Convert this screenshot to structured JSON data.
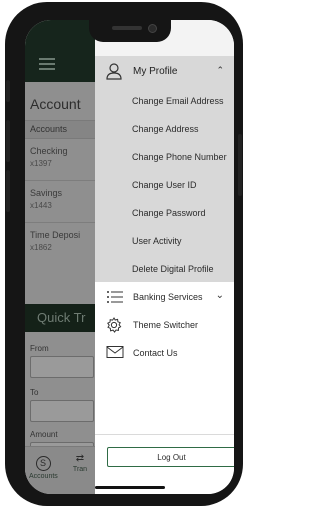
{
  "app": {
    "accounts_title": "Account",
    "accounts_subheader": "Accounts",
    "accounts": [
      {
        "name": "Checking",
        "number": "x1397"
      },
      {
        "name": "Savings",
        "number": "x1443"
      },
      {
        "name": "Time Deposi",
        "number": "x1862"
      }
    ],
    "quick_transfer_title": "Quick Tr",
    "form": {
      "from_label": "From",
      "to_label": "To",
      "amount_label": "Amount",
      "amount_prefix": "$"
    },
    "tabs": {
      "accounts_label": "Accounts",
      "accounts_icon_glyph": "S",
      "transfer_label": "Tran"
    }
  },
  "menu": {
    "my_profile": {
      "label": "My Profile",
      "icon": "user-icon",
      "expanded": true
    },
    "profile_items": [
      "Change Email Address",
      "Change Address",
      "Change Phone Number",
      "Change User ID",
      "Change Password",
      "User Activity",
      "Delete Digital Profile"
    ],
    "banking_services": {
      "label": "Banking Services",
      "icon": "list-icon"
    },
    "theme_switcher": {
      "label": "Theme Switcher",
      "icon": "gear-icon"
    },
    "contact_us": {
      "label": "Contact Us",
      "icon": "envelope-icon"
    },
    "logout_label": "Log Out"
  },
  "colors": {
    "brand_green": "#2f6b45",
    "header_dark": "#16251c",
    "submenu_bg": "#d8d8d8"
  }
}
